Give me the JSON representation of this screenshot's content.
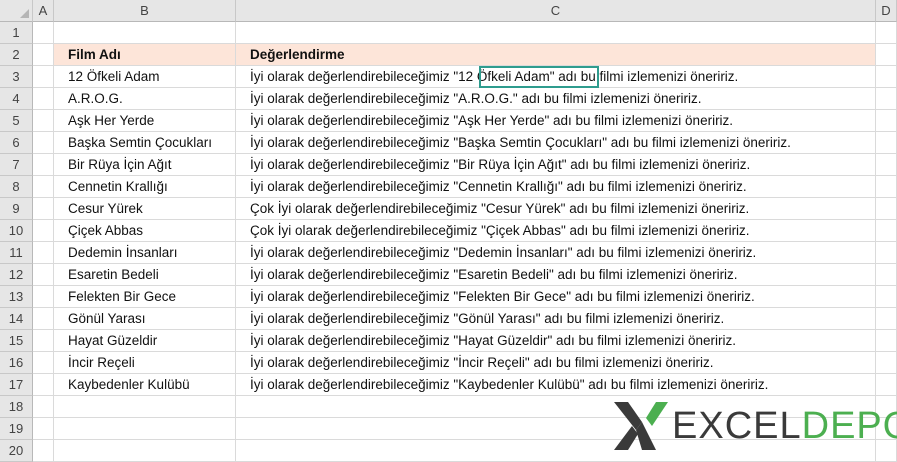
{
  "columns": [
    "A",
    "B",
    "C",
    "D"
  ],
  "rows": [
    "1",
    "2",
    "3",
    "4",
    "5",
    "6",
    "7",
    "8",
    "9",
    "10",
    "11",
    "12",
    "13",
    "14",
    "15",
    "16",
    "17",
    "18",
    "19",
    "20"
  ],
  "header": {
    "film": "Film Adı",
    "rating": "Değerlendirme"
  },
  "films": [
    {
      "name": "12 Öfkeli Adam",
      "pre": "İyi olarak değerlendirebileceğimiz ",
      "quote": "\"12 Öfkeli Adam\"",
      "post": " adı bu filmi izlemenizi öneririz."
    },
    {
      "name": "A.R.O.G.",
      "pre": "İyi olarak değerlendirebileceğimiz ",
      "quote": "\"A.R.O.G.\"",
      "post": " adı bu filmi izlemenizi öneririz."
    },
    {
      "name": "Aşk Her Yerde",
      "pre": "İyi olarak değerlendirebileceğimiz ",
      "quote": "\"Aşk Her Yerde\"",
      "post": " adı bu filmi izlemenizi öneririz."
    },
    {
      "name": "Başka Semtin Çocukları",
      "pre": "İyi olarak değerlendirebileceğimiz ",
      "quote": "\"Başka Semtin Çocukları\"",
      "post": " adı bu filmi izlemenizi öneririz."
    },
    {
      "name": "Bir Rüya İçin Ağıt",
      "pre": "İyi olarak değerlendirebileceğimiz ",
      "quote": "\"Bir Rüya İçin Ağıt\"",
      "post": " adı bu filmi izlemenizi öneririz."
    },
    {
      "name": "Cennetin Krallığı",
      "pre": "İyi olarak değerlendirebileceğimiz ",
      "quote": "\"Cennetin Krallığı\"",
      "post": " adı bu filmi izlemenizi öneririz."
    },
    {
      "name": "Cesur Yürek",
      "pre": "Çok İyi olarak değerlendirebileceğimiz ",
      "quote": "\"Cesur Yürek\"",
      "post": " adı bu filmi izlemenizi öneririz."
    },
    {
      "name": "Çiçek Abbas",
      "pre": "Çok İyi olarak değerlendirebileceğimiz ",
      "quote": "\"Çiçek Abbas\"",
      "post": " adı bu filmi izlemenizi öneririz."
    },
    {
      "name": "Dedemin İnsanları",
      "pre": "İyi olarak değerlendirebileceğimiz ",
      "quote": "\"Dedemin İnsanları\"",
      "post": " adı bu filmi izlemenizi öneririz."
    },
    {
      "name": "Esaretin Bedeli",
      "pre": "İyi olarak değerlendirebileceğimiz ",
      "quote": "\"Esaretin Bedeli\"",
      "post": " adı bu filmi izlemenizi öneririz."
    },
    {
      "name": "Felekten Bir Gece",
      "pre": "İyi olarak değerlendirebileceğimiz ",
      "quote": "\"Felekten Bir Gece\"",
      "post": " adı bu filmi izlemenizi öneririz."
    },
    {
      "name": "Gönül Yarası",
      "pre": "İyi olarak değerlendirebileceğimiz ",
      "quote": "\"Gönül Yarası\"",
      "post": " adı bu filmi izlemenizi öneririz."
    },
    {
      "name": "Hayat Güzeldir",
      "pre": "İyi olarak değerlendirebileceğimiz ",
      "quote": "\"Hayat Güzeldir\"",
      "post": " adı bu filmi izlemenizi öneririz."
    },
    {
      "name": "İncir Reçeli",
      "pre": "İyi olarak değerlendirebileceğimiz ",
      "quote": "\"İncir Reçeli\"",
      "post": " adı bu filmi izlemenizi öneririz."
    },
    {
      "name": "Kaybedenler Kulübü",
      "pre": "İyi olarak değerlendirebileceğimiz ",
      "quote": "\"Kaybedenler Kulübü\"",
      "post": " adı bu filmi izlemenizi öneririz."
    }
  ],
  "logo": {
    "part1": "EXCEL",
    "part2": "DEPO"
  },
  "colors": {
    "header_fill": "#fde5d9",
    "selection": "#2e9c8e",
    "brand_green": "#4caf50",
    "brand_dark": "#3a3a3a"
  }
}
